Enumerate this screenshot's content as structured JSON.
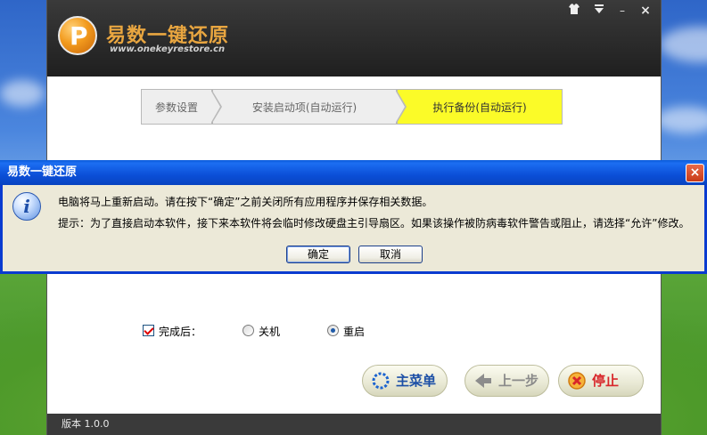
{
  "app": {
    "title": "易数一键还原",
    "url": "www.onekeyrestore.cn",
    "window_controls": [
      "shirt-icon",
      "menu-icon",
      "minimize-icon",
      "close-icon"
    ],
    "window_control_glyphs": {
      "minimize": "–",
      "close": "×"
    },
    "steps": [
      {
        "label": "参数设置",
        "active": false
      },
      {
        "label": "安装启动项(自动运行)",
        "active": false
      },
      {
        "label": "执行备份(自动运行)",
        "active": true
      }
    ],
    "options": {
      "after_label": "完成后：",
      "after_checked": true,
      "shutdown_label": "关机",
      "restart_label": "重启",
      "selected": "重启"
    },
    "buttons": {
      "main_menu": "主菜单",
      "prev_step": "上一步",
      "stop": "停止"
    },
    "footer": {
      "version": "版本 1.0.0"
    },
    "colors": {
      "active_step": "#fbfb28",
      "header": "#2b2b2b"
    }
  },
  "dialog": {
    "title": "易数一键还原",
    "close_glyph": "×",
    "icon": "info-icon",
    "message": "电脑将马上重新启动。请在按下“确定”之前关闭所有应用程序并保存相关数据。",
    "hint": "提示：为了直接启动本软件，接下来本软件将会临时修改硬盘主引导扇区。如果该操作被防病毒软件警告或阻止，请选择“允许”修改。",
    "ok_label": "确定",
    "cancel_label": "取消"
  }
}
